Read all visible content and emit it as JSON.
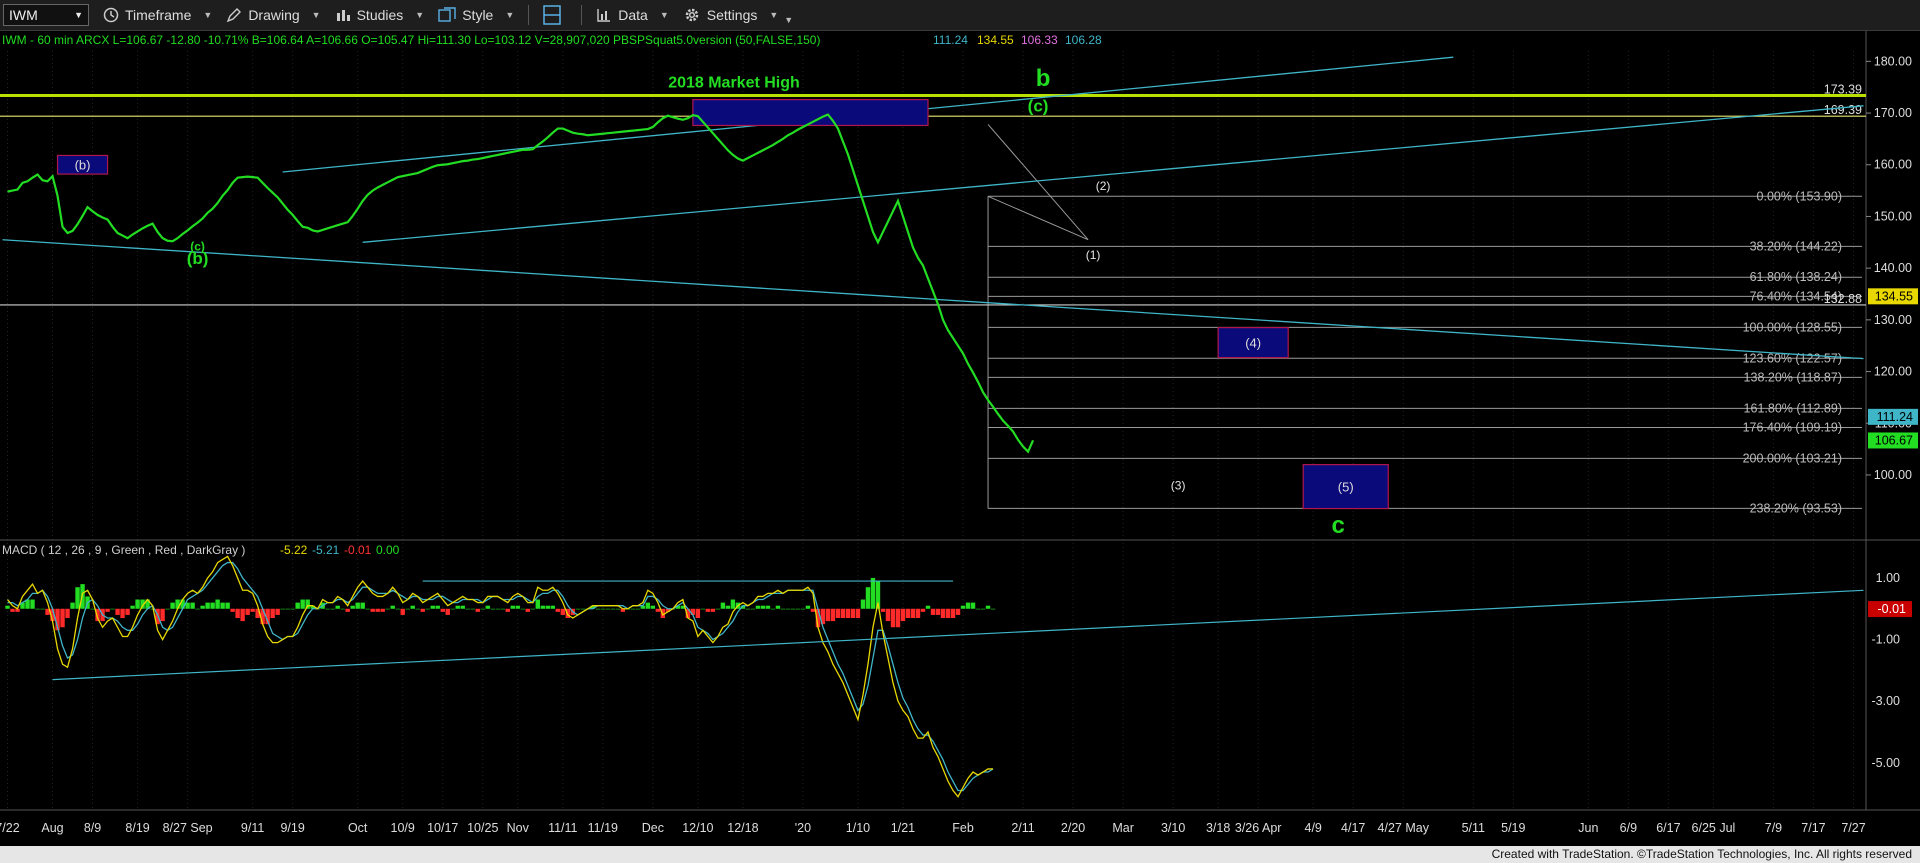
{
  "toolbar": {
    "symbol": "IWM",
    "timeframe_label": "Timeframe",
    "drawing_label": "Drawing",
    "studies_label": "Studies",
    "style_label": "Style",
    "data_label": "Data",
    "settings_label": "Settings"
  },
  "header": {
    "text": "IWM - 60 min  ARCX  L=106.67  -12.80  -10.71%  B=106.64  A=106.66  O=105.47  Hi=111.30  Lo=103.12  V=28,907,020  PBSPSquat5.0version (50,FALSE,150)",
    "study_values": [
      "111.24",
      "134.55",
      "106.33",
      "106.28"
    ]
  },
  "footer": {
    "text": "Created with TradeStation. ©TradeStation Technologies, Inc. All rights reserved"
  },
  "colors": {
    "background": "#000000",
    "price": "#22dd22",
    "trend": "#3fb5c8",
    "fib": "#9a9a9a",
    "market_high": "#b8e000",
    "zone_fill": "#0a0a7a",
    "zone_border": "#b0174f",
    "label_green": "#22dd22"
  },
  "chart_data": {
    "type": "line",
    "title": "",
    "y_axis": {
      "min": 88,
      "max": 182,
      "ticks": [
        180,
        170,
        160,
        150,
        140,
        130,
        120,
        110,
        100
      ],
      "tick_labels": [
        "180.00",
        "170.00",
        "160.00",
        "150.00",
        "140.00",
        "130.00",
        "120.00",
        "110.00",
        "100.00"
      ]
    },
    "x_axis": {
      "labels": [
        "7/22",
        "Aug",
        "8/9",
        "8/19",
        "8/27 Sep",
        "9/11",
        "9/19",
        "Oct",
        "10/9",
        "10/17",
        "10/25",
        "Nov",
        "11/11",
        "11/19",
        "Dec",
        "12/10",
        "12/18",
        "'20",
        "1/10",
        "1/21",
        "Feb",
        "2/11",
        "2/20",
        "Mar",
        "3/10",
        "3/18",
        "3/26 Apr",
        "4/9",
        "4/17",
        "4/27 May",
        "5/11",
        "5/19",
        "Jun",
        "6/9",
        "6/17",
        "6/25 Jul",
        "7/9",
        "7/17",
        "7/27"
      ],
      "label_index": [
        1,
        10,
        18,
        27,
        37,
        50,
        58,
        71,
        80,
        88,
        96,
        103,
        112,
        120,
        130,
        139,
        148,
        160,
        171,
        180,
        192,
        204,
        214,
        224,
        234,
        243,
        251,
        262,
        270,
        280,
        294,
        302,
        317,
        325,
        333,
        342,
        354,
        362,
        370
      ]
    },
    "series": [
      {
        "values": [
          154.8,
          155.0,
          155.2,
          156.5,
          156.8,
          157.5,
          158.1,
          157.0,
          156.8,
          157.8,
          154.0,
          148.0,
          146.8,
          147.2,
          148.5,
          150.1,
          151.8,
          151.0,
          150.3,
          149.8,
          149.4,
          148.0,
          146.8,
          146.3,
          145.8,
          146.5,
          147.1,
          147.7,
          148.2,
          148.6,
          147.0,
          145.8,
          145.3,
          145.2,
          145.8,
          146.6,
          147.3,
          148.1,
          148.8,
          149.6,
          150.7,
          151.5,
          152.6,
          154.0,
          155.1,
          156.5,
          157.5,
          157.6,
          157.7,
          157.6,
          157.5,
          156.5,
          155.5,
          154.6,
          153.7,
          152.5,
          151.3,
          150.3,
          149.1,
          148.0,
          147.8,
          147.3,
          147.1,
          147.4,
          147.7,
          148.0,
          148.3,
          148.6,
          148.9,
          150.1,
          151.5,
          153.0,
          154.2,
          155.0,
          155.6,
          156.1,
          156.6,
          157.1,
          157.6,
          157.8,
          158.0,
          158.2,
          158.4,
          158.8,
          159.2,
          159.6,
          159.9,
          160.0,
          160.1,
          160.3,
          160.5,
          160.7,
          160.8,
          161.0,
          161.1,
          161.3,
          161.5,
          161.7,
          161.9,
          162.1,
          162.3,
          162.5,
          162.7,
          162.9,
          162.9,
          163.0,
          163.8,
          164.5,
          165.3,
          166.2,
          167.0,
          167.0,
          166.6,
          166.2,
          166.0,
          165.9,
          165.7,
          165.8,
          165.9,
          166.0,
          166.1,
          166.2,
          166.3,
          166.4,
          166.5,
          166.6,
          166.7,
          166.8,
          166.9,
          167.3,
          168.2,
          169.0,
          169.5,
          169.2,
          168.9,
          168.7,
          169.0,
          169.6,
          169.4,
          168.3,
          167.2,
          166.1,
          165.0,
          163.9,
          162.8,
          161.9,
          161.2,
          160.8,
          161.3,
          161.8,
          162.3,
          162.8,
          163.3,
          163.8,
          164.4,
          165.0,
          165.7,
          166.2,
          166.8,
          167.3,
          167.8,
          168.3,
          168.8,
          169.3,
          169.7,
          168.5,
          167.0,
          164.5,
          162.0,
          159.0,
          156.0,
          153.0,
          150.0,
          147.0,
          145.0,
          147.0,
          149.0,
          151.0,
          153.0,
          150.0,
          147.0,
          144.0,
          142.0,
          140.5,
          138.0,
          135.5,
          133.0,
          130.0,
          128.0,
          126.5,
          125.0,
          123.5,
          121.5,
          119.8,
          118.0,
          116.0,
          114.5,
          113.2,
          111.8,
          110.5,
          109.5,
          108.4,
          106.8,
          105.5,
          104.5,
          106.7
        ],
        "x_start_index": 1
      }
    ],
    "fib_levels": [
      {
        "label": "0.00% (153.90)",
        "value": 153.9
      },
      {
        "label": "38.20% (144.22)",
        "value": 144.22
      },
      {
        "label": "61.80% (138.24)",
        "value": 138.24
      },
      {
        "label": "76.40% (134.54)",
        "value": 134.54
      },
      {
        "label": "100.00% (128.55)",
        "value": 128.55
      },
      {
        "label": "123.60% (122.57)",
        "value": 122.57
      },
      {
        "label": "138.20% (118.87)",
        "value": 118.87
      },
      {
        "label": "161.80% (112.89)",
        "value": 112.89
      },
      {
        "label": "176.40% (109.19)",
        "value": 109.19
      },
      {
        "label": "200.00% (103.21)",
        "value": 103.21
      },
      {
        "label": "238.20% (93.53)",
        "value": 93.53
      }
    ],
    "fib_anchor_index": 197,
    "horizontal_lines": [
      {
        "value": 173.39,
        "label": "173.39",
        "kind": "market-high"
      },
      {
        "value": 169.39,
        "label": "169.39",
        "kind": "yellow"
      },
      {
        "value": 132.88,
        "label": "132.88",
        "kind": "white"
      }
    ],
    "market_high_label": "2018 Market High",
    "trendlines": [
      {
        "from": [
          0,
          145.5
        ],
        "to": [
          372,
          122.5
        ]
      },
      {
        "from": [
          56,
          158.6
        ],
        "to": [
          290,
          180.8
        ]
      },
      {
        "from": [
          72,
          145.0
        ],
        "to": [
          372,
          171.4
        ]
      }
    ],
    "zones": [
      {
        "label": "(b)",
        "x0": 11,
        "x1": 21,
        "y0": 158.2,
        "y1": 161.8
      },
      {
        "label": "",
        "x0": 138,
        "x1": 185,
        "y0": 167.6,
        "y1": 172.6
      },
      {
        "label": "(4)",
        "x0": 243,
        "x1": 257,
        "y0": 122.7,
        "y1": 128.5
      },
      {
        "label": "(5)",
        "x0": 260,
        "x1": 277,
        "y0": 93.5,
        "y1": 102.0
      }
    ],
    "wave_labels": [
      {
        "text": "b",
        "x": 208,
        "y": 175.2,
        "size": 24,
        "color": "green"
      },
      {
        "text": "(c)",
        "x": 207,
        "y": 170.3,
        "size": 17,
        "color": "green"
      },
      {
        "text": "(b)",
        "x": 39,
        "y": 140.8,
        "size": 17,
        "color": "green"
      },
      {
        "text": "(c)",
        "x": 39,
        "y": 143.4,
        "size": 12,
        "color": "green"
      },
      {
        "text": "(2)",
        "x": 220,
        "y": 155.1,
        "size": 12,
        "color": "white"
      },
      {
        "text": "(1)",
        "x": 218,
        "y": 141.8,
        "size": 12,
        "color": "white"
      },
      {
        "text": "(3)",
        "x": 235,
        "y": 97.2,
        "size": 12,
        "color": "white"
      },
      {
        "text": "c",
        "x": 267,
        "y": 88.8,
        "size": 24,
        "color": "green"
      }
    ],
    "last_price_tags": [
      {
        "value": 134.55,
        "label": "134.55",
        "bg": "#e8d800",
        "fg": "#000"
      },
      {
        "value": 111.24,
        "label": "111.24",
        "bg": "#3fb5c8",
        "fg": "#000"
      },
      {
        "value": 106.67,
        "label": "106.67",
        "bg": "#22dd22",
        "fg": "#000"
      }
    ],
    "macd": {
      "header": "MACD ( 12 , 26 , 9 , Green , Red , DarkGray )",
      "header_values": [
        {
          "text": "-5.22",
          "color": "#e8d800"
        },
        {
          "text": "-5.21",
          "color": "#3fb5c8"
        },
        {
          "text": "-0.01",
          "color": "#ff3333"
        },
        {
          "text": "0.00",
          "color": "#22dd22"
        }
      ],
      "y_min": -6.5,
      "y_max": 2.2,
      "ticks": [
        1,
        -1,
        -3,
        -5
      ],
      "tick_labels": [
        "1.00",
        "-1.00",
        "-3.00",
        "-5.00"
      ],
      "last_tag": {
        "value": -0.01,
        "label": "-0.01"
      },
      "macd_line": [
        0.3,
        0.1,
        0.0,
        0.4,
        0.6,
        0.8,
        0.5,
        0.6,
        0.2,
        -0.4,
        -1.3,
        -1.8,
        -1.9,
        -1.3,
        -0.3,
        0.5,
        0.6,
        0.3,
        -0.3,
        -0.6,
        -0.4,
        -0.3,
        -0.6,
        -0.9,
        -0.9,
        -0.6,
        -0.2,
        0.1,
        0.3,
        0.1,
        -0.7,
        -1.0,
        -0.7,
        -0.4,
        0.0,
        0.3,
        0.5,
        0.6,
        0.5,
        0.7,
        1.0,
        1.2,
        1.5,
        1.6,
        1.7,
        1.4,
        1.0,
        0.6,
        0.6,
        0.5,
        0.1,
        -0.5,
        -0.9,
        -1.1,
        -1.1,
        -1.0,
        -0.9,
        -0.9,
        -0.6,
        -0.2,
        0.1,
        0.1,
        0.0,
        0.3,
        0.2,
        0.2,
        0.4,
        0.3,
        0.1,
        0.4,
        0.7,
        0.9,
        0.7,
        0.5,
        0.4,
        0.4,
        0.5,
        0.7,
        0.5,
        0.2,
        0.3,
        0.5,
        0.4,
        0.2,
        0.3,
        0.4,
        0.5,
        0.3,
        0.1,
        0.2,
        0.3,
        0.4,
        0.3,
        0.3,
        0.2,
        0.2,
        0.4,
        0.4,
        0.4,
        0.3,
        0.2,
        0.4,
        0.5,
        0.4,
        0.2,
        0.2,
        0.7,
        0.6,
        0.6,
        0.7,
        0.5,
        0.2,
        -0.2,
        -0.3,
        -0.2,
        -0.1,
        0.0,
        0.1,
        0.1,
        0.1,
        0.1,
        0.1,
        0.1,
        0.0,
        0.0,
        0.1,
        0.1,
        0.2,
        0.6,
        0.5,
        0.2,
        -0.2,
        -0.1,
        0.0,
        0.2,
        0.3,
        -0.3,
        -0.4,
        -0.9,
        -0.7,
        -0.9,
        -1.1,
        -0.9,
        -0.6,
        -0.5,
        -0.1,
        0.1,
        0.2,
        0.1,
        0.2,
        0.4,
        0.4,
        0.5,
        0.5,
        0.6,
        0.5,
        0.6,
        0.6,
        0.6,
        0.6,
        0.7,
        0.5,
        -0.6,
        -1.1,
        -1.4,
        -1.8,
        -2.1,
        -2.4,
        -2.8,
        -3.2,
        -3.6,
        -2.8,
        -1.8,
        -0.6,
        0.2,
        -0.8,
        -1.6,
        -2.4,
        -3.0,
        -3.3,
        -3.5,
        -3.9,
        -4.2,
        -4.2,
        -4.0,
        -4.5,
        -4.8,
        -5.2,
        -5.6,
        -5.9,
        -6.1,
        -5.8,
        -5.5,
        -5.3,
        -5.4,
        -5.3,
        -5.2,
        -5.2
      ],
      "signal_line": [
        0.2,
        0.2,
        0.1,
        0.2,
        0.3,
        0.5,
        0.5,
        0.6,
        0.4,
        0.0,
        -0.6,
        -1.2,
        -1.6,
        -1.5,
        -1.0,
        -0.3,
        0.2,
        0.3,
        0.1,
        -0.2,
        -0.3,
        -0.3,
        -0.4,
        -0.6,
        -0.7,
        -0.7,
        -0.5,
        -0.2,
        0.0,
        0.1,
        -0.2,
        -0.6,
        -0.7,
        -0.6,
        -0.3,
        0.0,
        0.3,
        0.4,
        0.5,
        0.6,
        0.8,
        1.0,
        1.2,
        1.4,
        1.5,
        1.5,
        1.3,
        1.0,
        0.8,
        0.6,
        0.4,
        0.0,
        -0.4,
        -0.8,
        -0.9,
        -1.0,
        -0.9,
        -0.9,
        -0.8,
        -0.5,
        -0.2,
        0.0,
        0.0,
        0.1,
        0.2,
        0.2,
        0.3,
        0.3,
        0.2,
        0.3,
        0.5,
        0.7,
        0.7,
        0.6,
        0.5,
        0.5,
        0.5,
        0.6,
        0.5,
        0.4,
        0.3,
        0.4,
        0.4,
        0.3,
        0.3,
        0.3,
        0.4,
        0.4,
        0.3,
        0.2,
        0.2,
        0.3,
        0.3,
        0.3,
        0.3,
        0.2,
        0.3,
        0.4,
        0.4,
        0.3,
        0.3,
        0.3,
        0.4,
        0.4,
        0.3,
        0.2,
        0.4,
        0.5,
        0.5,
        0.6,
        0.6,
        0.4,
        0.1,
        -0.1,
        -0.2,
        -0.1,
        0.0,
        0.0,
        0.1,
        0.1,
        0.1,
        0.1,
        0.1,
        0.1,
        0.0,
        0.1,
        0.1,
        0.1,
        0.4,
        0.4,
        0.3,
        0.1,
        0.0,
        0.0,
        0.1,
        0.2,
        0.0,
        -0.2,
        -0.6,
        -0.7,
        -0.8,
        -1.0,
        -0.9,
        -0.8,
        -0.6,
        -0.4,
        -0.1,
        0.1,
        0.1,
        0.2,
        0.3,
        0.3,
        0.4,
        0.5,
        0.5,
        0.5,
        0.6,
        0.6,
        0.6,
        0.6,
        0.6,
        0.6,
        0.0,
        -0.6,
        -1.0,
        -1.4,
        -1.8,
        -2.1,
        -2.5,
        -2.9,
        -3.3,
        -3.1,
        -2.5,
        -1.6,
        -0.7,
        -0.7,
        -1.2,
        -1.8,
        -2.4,
        -2.9,
        -3.2,
        -3.6,
        -3.9,
        -4.1,
        -4.1,
        -4.3,
        -4.6,
        -4.9,
        -5.3,
        -5.6,
        -5.9,
        -5.9,
        -5.7,
        -5.5,
        -5.4,
        -5.3,
        -5.3,
        -5.2
      ],
      "histogram": [
        0.1,
        -0.1,
        -0.1,
        0.2,
        0.3,
        0.3,
        0.0,
        0.0,
        -0.2,
        -0.4,
        -0.7,
        -0.6,
        -0.3,
        0.2,
        0.7,
        0.8,
        0.4,
        0.0,
        -0.4,
        -0.4,
        -0.1,
        0.0,
        -0.2,
        -0.3,
        -0.2,
        0.1,
        0.3,
        0.3,
        0.3,
        0.0,
        -0.5,
        -0.4,
        0.0,
        0.2,
        0.3,
        0.3,
        0.2,
        0.2,
        0.0,
        0.1,
        0.2,
        0.2,
        0.3,
        0.2,
        0.2,
        -0.1,
        -0.3,
        -0.4,
        -0.2,
        -0.1,
        -0.3,
        -0.5,
        -0.5,
        -0.3,
        -0.2,
        0.0,
        0.0,
        0.0,
        0.2,
        0.3,
        0.3,
        0.1,
        0.0,
        0.2,
        0.0,
        0.0,
        0.1,
        0.0,
        -0.1,
        0.1,
        0.2,
        0.2,
        0.0,
        -0.1,
        -0.1,
        -0.1,
        0.0,
        0.1,
        0.0,
        -0.2,
        0.0,
        0.1,
        0.0,
        -0.1,
        0.0,
        0.1,
        0.1,
        -0.1,
        -0.2,
        0.0,
        0.1,
        0.1,
        0.0,
        0.0,
        -0.1,
        0.0,
        0.1,
        0.0,
        0.0,
        0.0,
        -0.1,
        0.1,
        0.1,
        0.0,
        -0.1,
        0.0,
        0.3,
        0.1,
        0.1,
        0.1,
        -0.1,
        -0.2,
        -0.3,
        -0.2,
        0.0,
        0.0,
        0.0,
        0.1,
        0.0,
        0.0,
        0.0,
        0.0,
        0.0,
        -0.1,
        0.0,
        0.0,
        0.0,
        0.1,
        0.2,
        0.1,
        -0.1,
        -0.3,
        -0.1,
        0.0,
        0.1,
        0.1,
        -0.3,
        -0.2,
        -0.3,
        0.0,
        -0.1,
        -0.1,
        0.0,
        0.2,
        0.1,
        0.3,
        0.2,
        0.1,
        0.0,
        0.0,
        0.1,
        0.1,
        0.1,
        0.0,
        0.1,
        0.0,
        0.0,
        0.0,
        0.0,
        0.0,
        0.1,
        -0.1,
        -0.6,
        -0.5,
        -0.4,
        -0.4,
        -0.3,
        -0.3,
        -0.3,
        -0.3,
        -0.3,
        0.3,
        0.7,
        1.0,
        0.9,
        -0.1,
        -0.4,
        -0.6,
        -0.6,
        -0.4,
        -0.3,
        -0.3,
        -0.3,
        -0.1,
        0.1,
        -0.2,
        -0.2,
        -0.3,
        -0.3,
        -0.3,
        -0.2,
        0.1,
        0.2,
        0.2,
        0.0,
        0.0,
        0.1,
        0.0
      ],
      "trendlines": [
        {
          "from": [
            10,
            -2.3
          ],
          "to": [
            372,
            0.6
          ]
        },
        {
          "from": [
            84,
            0.9
          ],
          "to": [
            190,
            0.9
          ]
        }
      ]
    }
  }
}
